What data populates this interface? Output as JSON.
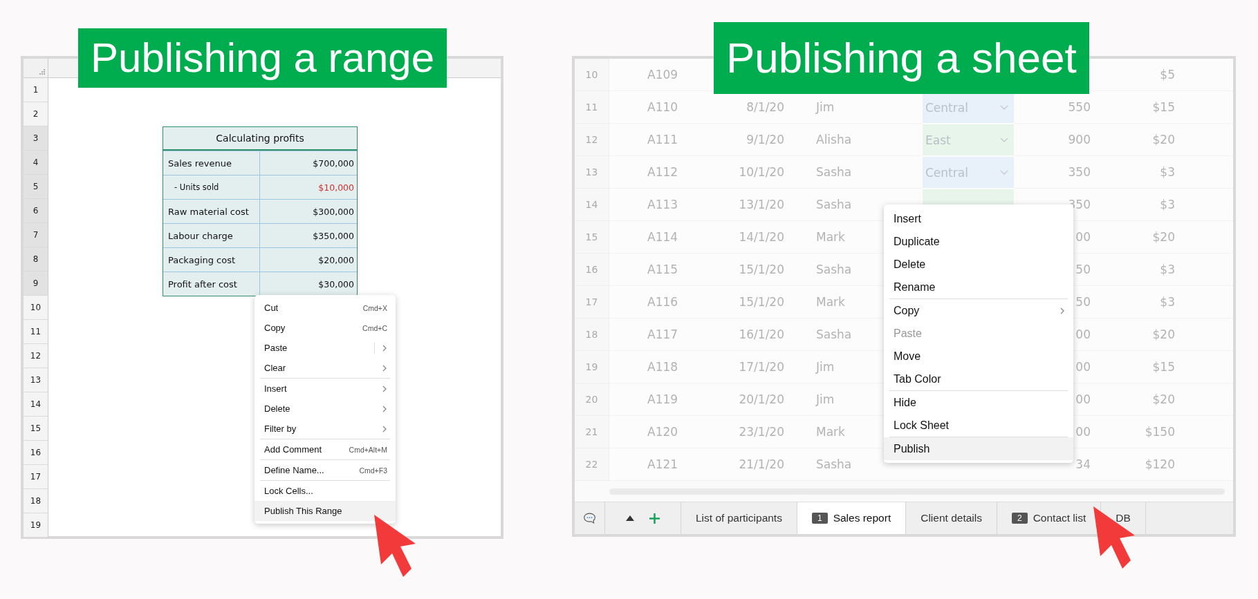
{
  "range_example": {
    "title": "Publishing a range",
    "row_headers": [
      {
        "label": "1",
        "selected": false
      },
      {
        "label": "2",
        "selected": false
      },
      {
        "label": "3",
        "selected": true
      },
      {
        "label": "4",
        "selected": true
      },
      {
        "label": "5",
        "selected": true
      },
      {
        "label": "6",
        "selected": true
      },
      {
        "label": "7",
        "selected": true
      },
      {
        "label": "8",
        "selected": true
      },
      {
        "label": "9",
        "selected": true
      },
      {
        "label": "10",
        "selected": false
      },
      {
        "label": "11",
        "selected": false
      },
      {
        "label": "12",
        "selected": false
      },
      {
        "label": "13",
        "selected": false
      },
      {
        "label": "14",
        "selected": false
      },
      {
        "label": "15",
        "selected": false
      },
      {
        "label": "16",
        "selected": false
      },
      {
        "label": "17",
        "selected": false
      },
      {
        "label": "18",
        "selected": false
      },
      {
        "label": "19",
        "selected": false
      }
    ],
    "table": {
      "title": "Calculating profits",
      "rows": [
        {
          "kind": "item",
          "label": "Sales revenue",
          "value": "$700,000",
          "color": "#111111"
        },
        {
          "kind": "sub",
          "label": "- Units sold",
          "value": "$10,000",
          "color": "#d62f2f"
        },
        {
          "kind": "item",
          "label": "Raw material cost",
          "value": "$300,000",
          "color": "#111111"
        },
        {
          "kind": "item",
          "label": "Labour charge",
          "value": "$350,000",
          "color": "#111111"
        },
        {
          "kind": "item",
          "label": "Packaging cost",
          "value": "$20,000",
          "color": "#111111"
        },
        {
          "kind": "item",
          "label": "Profit after cost",
          "value": "$30,000",
          "color": "#111111"
        }
      ]
    },
    "menu": {
      "groups": [
        {
          "items": [
            {
              "label": "Cut",
              "shortcut": "Cmd+X",
              "submenu": false,
              "split": false,
              "highlighted": false
            },
            {
              "label": "Copy",
              "shortcut": "Cmd+C",
              "submenu": false,
              "split": false,
              "highlighted": false
            },
            {
              "label": "Paste",
              "submenu": true,
              "split": true,
              "highlighted": false
            },
            {
              "label": "Clear",
              "submenu": true,
              "split": false,
              "highlighted": false
            }
          ]
        },
        {
          "items": [
            {
              "label": "Insert",
              "submenu": true,
              "split": false,
              "highlighted": false
            },
            {
              "label": "Delete",
              "submenu": true,
              "split": false,
              "highlighted": false
            },
            {
              "label": "Filter by",
              "submenu": true,
              "split": false,
              "highlighted": false
            }
          ]
        },
        {
          "items": [
            {
              "label": "Add Comment",
              "shortcut": "Cmd+Alt+M",
              "submenu": false,
              "split": false,
              "highlighted": false
            }
          ]
        },
        {
          "items": [
            {
              "label": "Define Name...",
              "shortcut": "Cmd+F3",
              "submenu": false,
              "split": false,
              "highlighted": false
            }
          ]
        },
        {
          "items": [
            {
              "label": "Lock Cells...",
              "submenu": false,
              "split": false,
              "highlighted": false
            },
            {
              "label": "Publish This Range",
              "submenu": false,
              "split": false,
              "highlighted": true
            }
          ]
        }
      ]
    }
  },
  "sheet_example": {
    "title": "Publishing a sheet",
    "rows": [
      {
        "number": "10",
        "id": "A109",
        "price": "$5"
      },
      {
        "number": "11",
        "id": "A110",
        "date": "8/1/20",
        "name": "Jim",
        "region": {
          "label": "Central",
          "color": "#e8f0fa"
        },
        "units": "550",
        "price": "$15"
      },
      {
        "number": "12",
        "id": "A111",
        "date": "9/1/20",
        "name": "Alisha",
        "region": {
          "label": "East",
          "color": "#e7f5ea"
        },
        "units": "900",
        "price": "$20"
      },
      {
        "number": "13",
        "id": "A112",
        "date": "10/1/20",
        "name": "Sasha",
        "region": {
          "label": "Central",
          "color": "#e8f0fa"
        },
        "units": "350",
        "price": "$3"
      },
      {
        "number": "14",
        "id": "A113",
        "date": "13/1/20",
        "name": "Sasha",
        "region": {
          "color": "#e7f5ea"
        },
        "units": "350",
        "price": "$3"
      },
      {
        "number": "15",
        "id": "A114",
        "date": "14/1/20",
        "name": "Mark",
        "units": "00",
        "price": "$20"
      },
      {
        "number": "16",
        "id": "A115",
        "date": "15/1/20",
        "name": "Sasha",
        "units": "50",
        "price": "$3"
      },
      {
        "number": "17",
        "id": "A116",
        "date": "15/1/20",
        "name": "Mark",
        "units": "50",
        "price": "$3"
      },
      {
        "number": "18",
        "id": "A117",
        "date": "16/1/20",
        "name": "Sasha",
        "units": "00",
        "price": "$20"
      },
      {
        "number": "19",
        "id": "A118",
        "date": "17/1/20",
        "name": "Jim",
        "units": "00",
        "price": "$15"
      },
      {
        "number": "20",
        "id": "A119",
        "date": "20/1/20",
        "name": "Jim",
        "units": "00",
        "price": "$20"
      },
      {
        "number": "21",
        "id": "A120",
        "date": "23/1/20",
        "name": "Mark",
        "units": "00",
        "price": "$150"
      },
      {
        "number": "22",
        "id": "A121",
        "date": "21/1/20",
        "name": "Sasha",
        "units": "34",
        "price": "$120"
      }
    ],
    "menu": {
      "groups": [
        {
          "items": [
            {
              "label": "Insert",
              "submenu": false,
              "disabled": false,
              "highlighted": false
            },
            {
              "label": "Duplicate",
              "submenu": false,
              "disabled": false,
              "highlighted": false
            },
            {
              "label": "Delete",
              "submenu": false,
              "disabled": false,
              "highlighted": false
            },
            {
              "label": "Rename",
              "submenu": false,
              "disabled": false,
              "highlighted": false
            }
          ]
        },
        {
          "items": [
            {
              "label": "Copy",
              "submenu": true,
              "disabled": false,
              "highlighted": false
            },
            {
              "label": "Paste",
              "submenu": false,
              "disabled": true,
              "highlighted": false
            },
            {
              "label": "Move",
              "submenu": false,
              "disabled": false,
              "highlighted": false
            },
            {
              "label": "Tab Color",
              "submenu": false,
              "disabled": false,
              "highlighted": false
            }
          ]
        },
        {
          "items": [
            {
              "label": "Hide",
              "submenu": false,
              "disabled": false,
              "highlighted": false
            },
            {
              "label": "Lock Sheet",
              "submenu": false,
              "disabled": false,
              "highlighted": false
            }
          ]
        },
        {
          "items": [
            {
              "label": "Publish",
              "submenu": false,
              "disabled": false,
              "highlighted": true
            }
          ]
        }
      ]
    },
    "tabs": [
      {
        "label": "List of participants",
        "selected": false
      },
      {
        "label": "Sales report",
        "badge": "1",
        "selected": true
      },
      {
        "label": "Client details",
        "selected": false
      },
      {
        "label": "Contact list",
        "badge": "2",
        "selected": false
      },
      {
        "label": "DB",
        "selected": false
      }
    ]
  }
}
